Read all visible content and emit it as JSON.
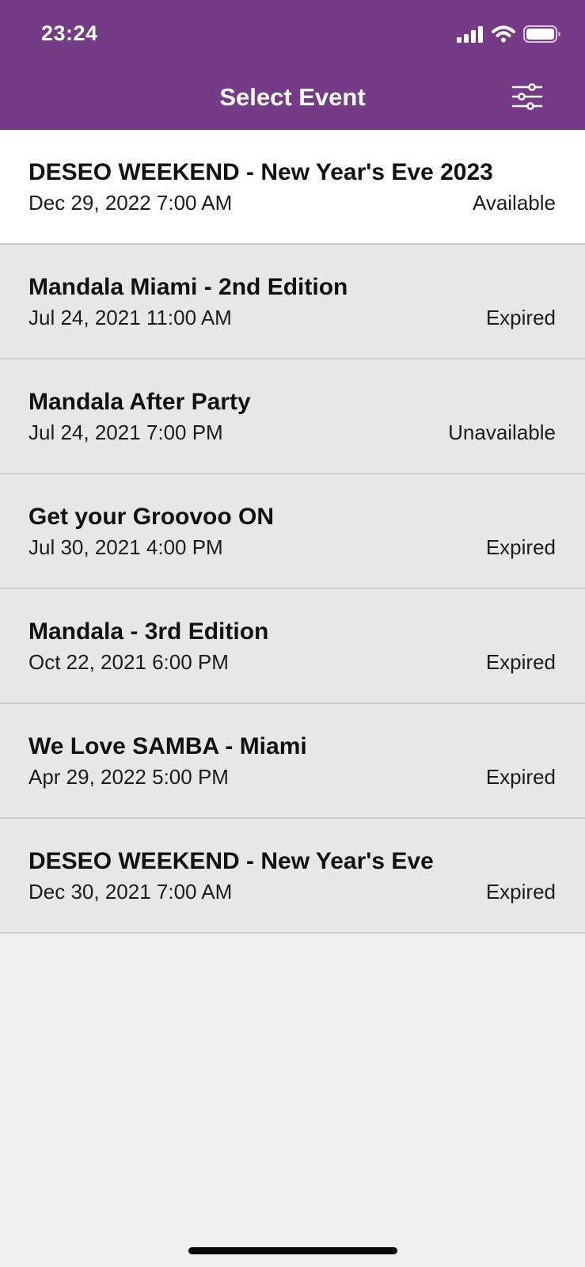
{
  "status_bar": {
    "time": "23:24",
    "icons": [
      "cellular-signal-icon",
      "wifi-icon",
      "battery-icon"
    ]
  },
  "nav": {
    "title": "Select Event",
    "filter_icon": "sliders-icon"
  },
  "colors": {
    "header": "#753b87",
    "available_row": "#ffffff",
    "inactive_row": "#e7e7e7",
    "background": "#f0f0f0"
  },
  "events": [
    {
      "name": "DESEO WEEKEND - New Year's Eve 2023",
      "date": "Dec 29, 2022 7:00 AM",
      "status": "Available"
    },
    {
      "name": "Mandala Miami - 2nd Edition",
      "date": "Jul 24, 2021 11:00 AM",
      "status": "Expired"
    },
    {
      "name": "Mandala After Party",
      "date": "Jul 24, 2021 7:00 PM",
      "status": "Unavailable"
    },
    {
      "name": "Get your Groovoo ON",
      "date": "Jul 30, 2021 4:00 PM",
      "status": "Expired"
    },
    {
      "name": "Mandala - 3rd Edition",
      "date": "Oct 22, 2021 6:00 PM",
      "status": "Expired"
    },
    {
      "name": "We Love SAMBA - Miami",
      "date": "Apr 29, 2022 5:00 PM",
      "status": "Expired"
    },
    {
      "name": "DESEO WEEKEND - New Year's Eve",
      "date": "Dec 30, 2021 7:00 AM",
      "status": "Expired"
    }
  ]
}
